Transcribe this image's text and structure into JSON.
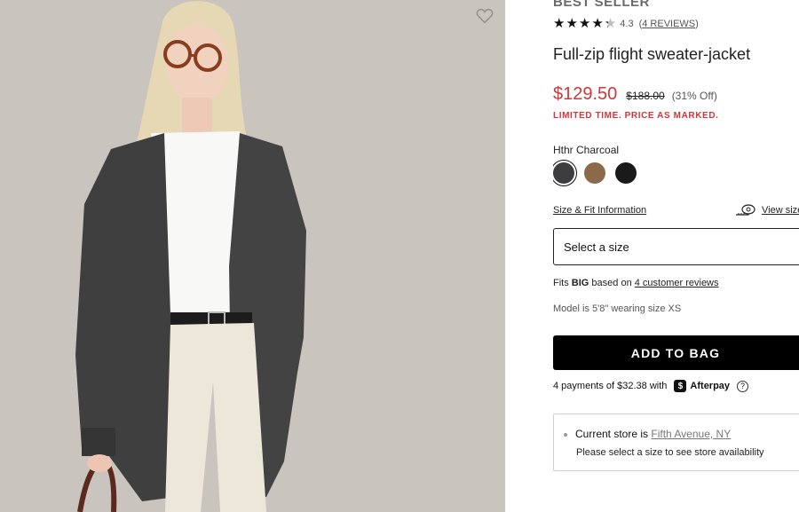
{
  "product": {
    "badge": "BEST SELLER",
    "rating_value": "4.3",
    "reviews_link": "4 REVIEWS",
    "title": "Full-zip flight sweater-jacket",
    "price_sale": "$129.50",
    "price_original": "$188.00",
    "price_off": "(31% Off)",
    "promo": "LIMITED TIME. PRICE AS MARKED."
  },
  "rating": {
    "stars": 4.3,
    "max": 5
  },
  "color": {
    "selected_label": "Hthr Charcoal",
    "swatches": [
      {
        "name": "Hthr Charcoal",
        "color": "#3d3d3f",
        "selected": true
      },
      {
        "name": "Brown",
        "color": "#8b6a4a",
        "selected": false
      },
      {
        "name": "Black",
        "color": "#1a1a1a",
        "selected": false
      }
    ]
  },
  "size": {
    "fit_info_link": "Size & Fit Information",
    "view_size_link": "View size",
    "select_placeholder": "Select a size",
    "fits_prefix": "Fits",
    "fits_value": "BIG",
    "fits_mid": "based on",
    "fits_link": "4 customer reviews",
    "model_note": "Model is 5'8\" wearing size XS"
  },
  "actions": {
    "add_to_bag": "ADD TO BAG"
  },
  "afterpay": {
    "text": "4 payments of $32.38 with",
    "icon_glyph": "$",
    "brand": "Afterpay",
    "help_glyph": "?"
  },
  "store": {
    "label": "Current store is",
    "store_name": "Fifth Avenue, NY",
    "note": "Please select a size to see store availability"
  },
  "icons": {
    "wishlist": "heart-outline-icon",
    "ruler": "measuring-tape-icon",
    "afterpay": "afterpay-icon",
    "help": "question-circle-icon"
  }
}
